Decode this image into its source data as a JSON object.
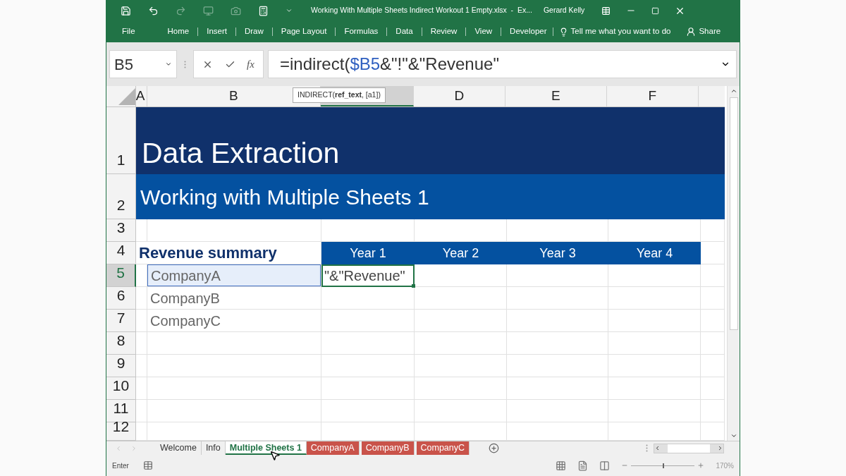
{
  "window": {
    "title": "Working With Multiple Sheets Indirect Workout 1 Empty.xlsx  -  Ex...",
    "user": "Gerard Kelly"
  },
  "ribbon": {
    "tabs": [
      {
        "label": "File",
        "selected": false
      },
      {
        "label": "Home",
        "selected": false
      },
      {
        "label": "Insert",
        "selected": false
      },
      {
        "label": "Draw",
        "selected": false
      },
      {
        "label": "Page Layout",
        "selected": false
      },
      {
        "label": "Formulas",
        "selected": false
      },
      {
        "label": "Data",
        "selected": false
      },
      {
        "label": "Review",
        "selected": false
      },
      {
        "label": "View",
        "selected": false
      },
      {
        "label": "Developer",
        "selected": false
      }
    ],
    "tell_me": "Tell me what you want to do",
    "share": "Share"
  },
  "formula_bar": {
    "name_box": "B5",
    "fx": "fx",
    "formula": [
      {
        "text": "=indirect(",
        "ref": false
      },
      {
        "text": "$B5",
        "ref": true
      },
      {
        "text": "&\"!\"&\"Revenue\"",
        "ref": false
      }
    ]
  },
  "tooltip": "INDIRECT(**ref_text**, [a1])",
  "columns": [
    {
      "label": "A",
      "active": false
    },
    {
      "label": "B",
      "active": false
    },
    {
      "active": true
    },
    {
      "label": "D",
      "active": false
    },
    {
      "label": "E",
      "active": false
    },
    {
      "label": "F",
      "active": false
    }
  ],
  "rows": [
    {
      "number": "1",
      "kind": "title",
      "text": "Data Extraction",
      "active": false
    },
    {
      "number": "2",
      "kind": "subtitle",
      "text": "Working with Multiple Sheets 1",
      "active": false
    },
    {
      "number": "3",
      "kind": "blank",
      "active": false
    },
    {
      "number": "4",
      "kind": "header",
      "text": "Revenue summary",
      "years": [
        "Year 1",
        "Year 2",
        "Year 3",
        "Year 4"
      ],
      "active": false
    },
    {
      "number": "5",
      "kind": "company",
      "text": "CompanyA",
      "referenced": true,
      "value": "\"&\"Revenue\"",
      "active": true
    },
    {
      "number": "6",
      "kind": "company",
      "text": "CompanyB",
      "referenced": false,
      "active": false
    },
    {
      "number": "7",
      "kind": "company",
      "text": "CompanyC",
      "referenced": false,
      "active": false
    },
    {
      "number": "8",
      "kind": "blank",
      "active": false
    },
    {
      "number": "9",
      "kind": "blank",
      "active": false
    },
    {
      "number": "10",
      "kind": "blank",
      "active": false
    },
    {
      "number": "11",
      "kind": "blank",
      "active": false
    },
    {
      "number": "12",
      "kind": "blank",
      "active": false
    }
  ],
  "sheet_tabs": [
    {
      "label": "Welcome",
      "selected": false
    },
    {
      "label": "Info",
      "selected": false
    },
    {
      "label": "Multiple Sheets 1",
      "selected": true
    },
    {
      "label": "CompanyA",
      "selected": false,
      "color": "#c9534a"
    },
    {
      "label": "CompanyB",
      "selected": false,
      "color": "#c9534a"
    },
    {
      "label": "CompanyC",
      "selected": false,
      "color": "#c9534a"
    }
  ],
  "status": {
    "mode": "Enter",
    "zoom": "170%",
    "level": 0.5
  }
}
